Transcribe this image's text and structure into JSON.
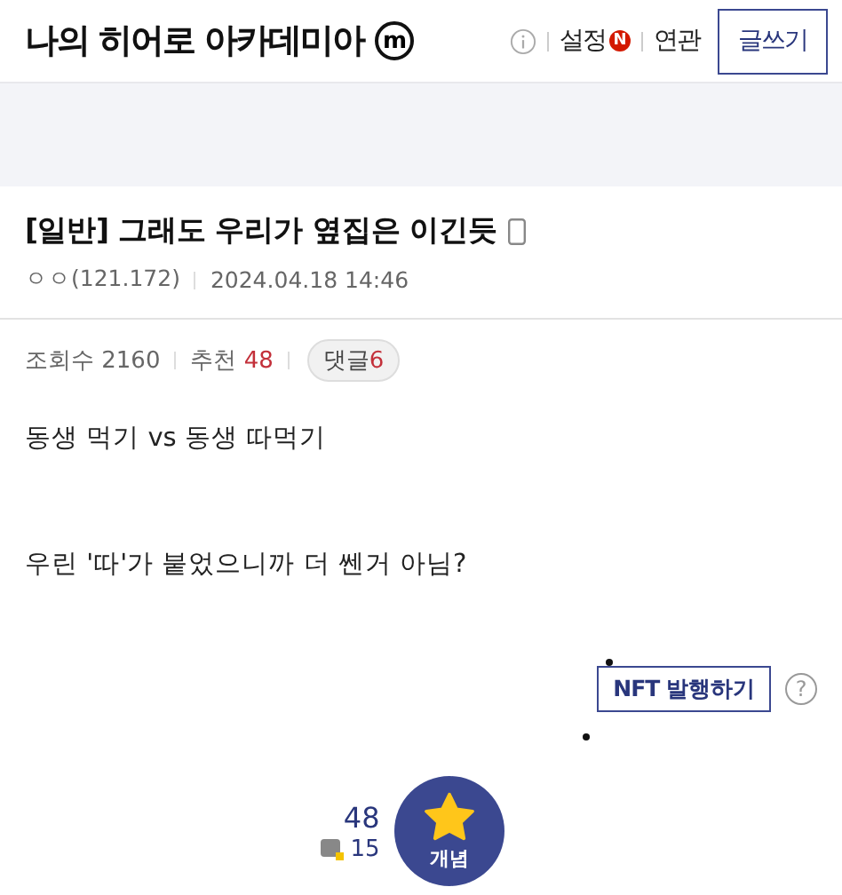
{
  "header": {
    "gallery_name": "나의 히어로 아카데미아",
    "gallery_badge": "m",
    "links": [
      {
        "label": "설정",
        "badge": "N"
      },
      {
        "label": "연관"
      }
    ],
    "write_button": "글쓰기"
  },
  "post": {
    "title": "[일반] 그래도 우리가 옆집은 이긴듯",
    "author": "ㅇㅇ(121.172)",
    "date": "2024.04.18 14:46",
    "views_label": "조회수",
    "views": "2160",
    "recommend_label": "추천",
    "recommend": "48",
    "comments_label": "댓글",
    "comments": "6",
    "body": [
      "동생 먹기 vs 동생 따먹기",
      "우린 '따'가 붙었으니까 더 쎈거 아님?"
    ],
    "nft_button": "NFT 발행하기",
    "help": "?"
  },
  "vote": {
    "count": "48",
    "fixed_count": "15",
    "button_label": "개념"
  }
}
